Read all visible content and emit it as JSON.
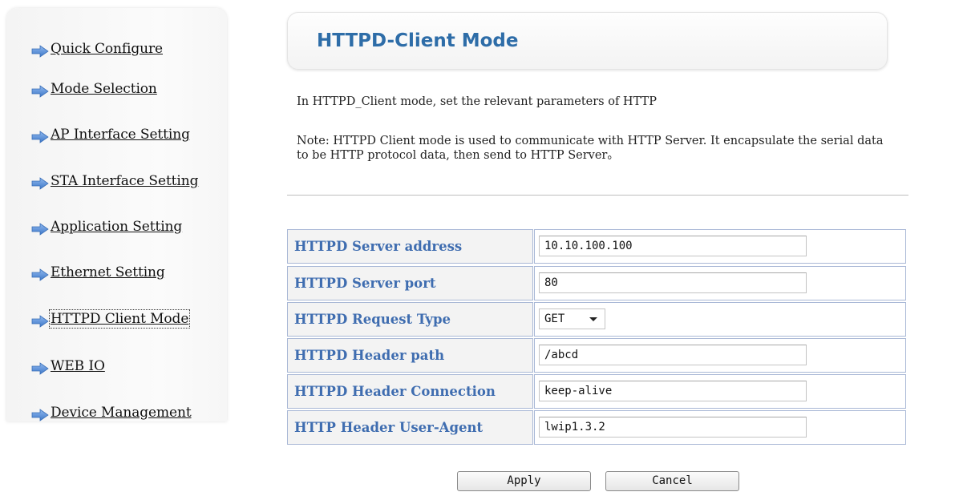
{
  "sidebar": {
    "items": [
      {
        "label": "Quick Configure",
        "icon": "arrow-right-icon"
      },
      {
        "label": "Mode Selection",
        "icon": "arrow-right-icon"
      },
      {
        "label": "AP Interface Setting",
        "icon": "arrow-right-icon"
      },
      {
        "label": "STA Interface Setting",
        "icon": "arrow-right-icon"
      },
      {
        "label": "Application Setting",
        "icon": "arrow-right-icon"
      },
      {
        "label": "Ethernet Setting",
        "icon": "arrow-right-icon"
      },
      {
        "label": "HTTPD Client Mode",
        "icon": "arrow-right-icon",
        "active": true
      },
      {
        "label": "WEB IO",
        "icon": "arrow-right-icon"
      },
      {
        "label": "Device Management",
        "icon": "arrow-right-icon"
      }
    ]
  },
  "header": {
    "title": "HTTPD-Client Mode"
  },
  "main": {
    "intro": "In HTTPD_Client mode, set the relevant parameters of HTTP",
    "note": "Note: HTTPD Client mode is used to communicate with HTTP Server. It encapsulate the serial data to be HTTP protocol data, then send to HTTP Server。",
    "fields": {
      "server_address": {
        "label": "HTTPD Server address",
        "value": "10.10.100.100"
      },
      "server_port": {
        "label": "HTTPD Server port",
        "value": "80"
      },
      "request_type": {
        "label": "HTTPD Request Type",
        "value": "GET"
      },
      "header_path": {
        "label": "HTTPD Header path",
        "value": "/abcd"
      },
      "header_connection": {
        "label": "HTTPD Header Connection",
        "value": "keep-alive"
      },
      "user_agent": {
        "label": "HTTP Header User-Agent",
        "value": "lwip1.3.2"
      }
    },
    "buttons": {
      "apply": "Apply",
      "cancel": "Cancel"
    }
  },
  "colors": {
    "accent_title": "#2e6da8",
    "label_text": "#3f6db0",
    "table_border": "#a9b8d6",
    "arrow_icon": "#5b8fd6"
  }
}
